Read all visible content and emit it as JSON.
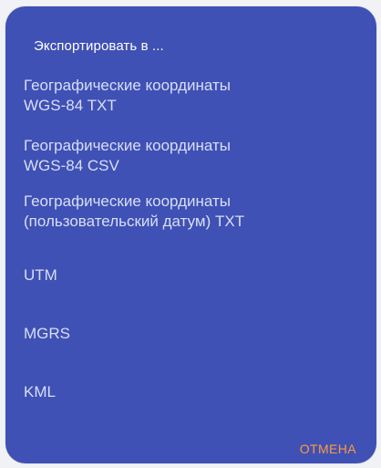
{
  "dialog": {
    "title": "Экспортировать в ...",
    "options": [
      {
        "line1": "Географические координаты",
        "line2": "WGS-84 TXT"
      },
      {
        "line1": "Географические координаты",
        "line2": "WGS-84 CSV"
      },
      {
        "line1": "Географические координаты",
        "line2": "(пользовательский датум) TXT"
      },
      {
        "line1": "UTM",
        "line2": ""
      },
      {
        "line1": "MGRS",
        "line2": ""
      },
      {
        "line1": "KML",
        "line2": ""
      }
    ],
    "cancel_label": "ОТМЕНА"
  },
  "colors": {
    "dialog_background": "#3f51b5",
    "title_text": "#ffffff",
    "option_text": "#d9def5",
    "accent": "#ff9a3c"
  }
}
